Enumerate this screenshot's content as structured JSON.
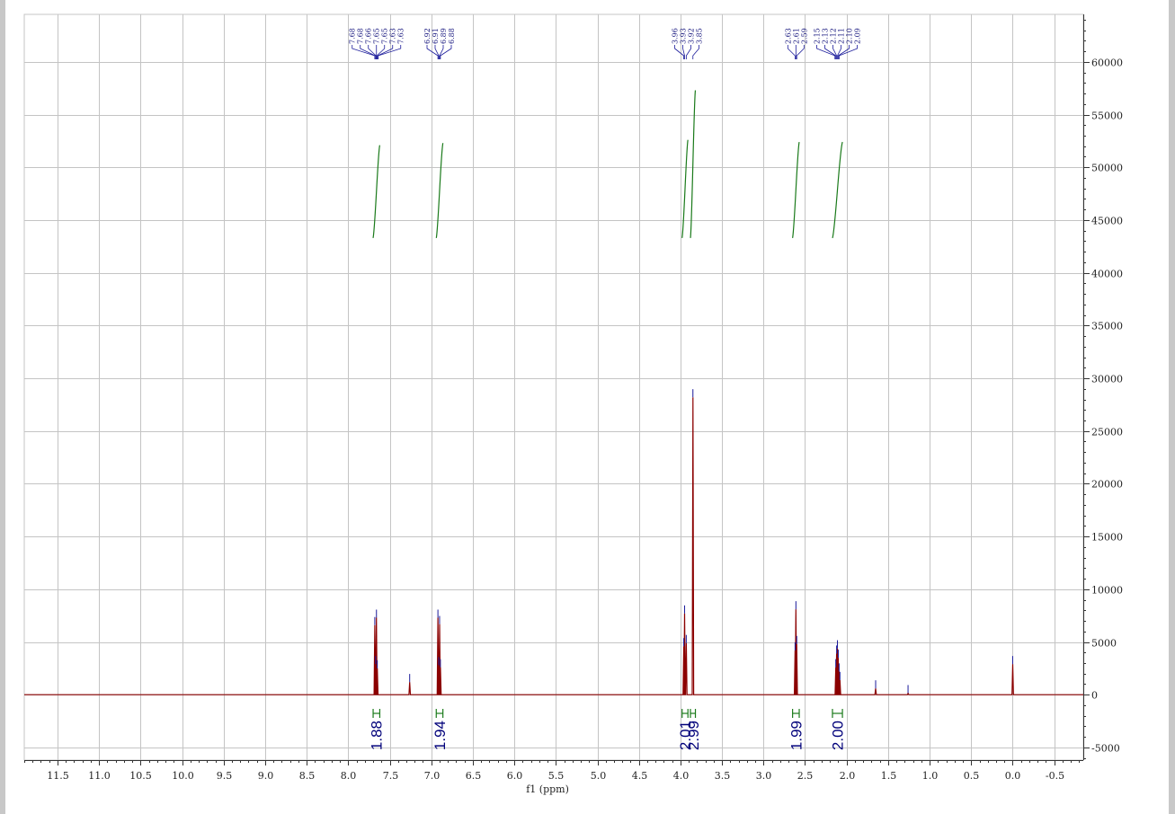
{
  "chart_data": {
    "type": "line",
    "title": "",
    "xlabel": "f1 (ppm)",
    "ylabel": "",
    "xlim": [
      11.9,
      -0.85
    ],
    "ylim": [
      -6200,
      64500
    ],
    "x_ticks": [
      11.5,
      11.0,
      10.5,
      10.0,
      9.5,
      9.0,
      8.5,
      8.0,
      7.5,
      7.0,
      6.5,
      6.0,
      5.5,
      5.0,
      4.5,
      4.0,
      3.5,
      3.0,
      2.5,
      2.0,
      1.5,
      1.0,
      0.5,
      0.0,
      -0.5
    ],
    "x_tick_labels": [
      "11.5",
      "11.0",
      "10.5",
      "10.0",
      "9.5",
      "9.0",
      "8.5",
      "8.0",
      "7.5",
      "7.0",
      "6.5",
      "6.0",
      "5.5",
      "5.0",
      "4.5",
      "4.0",
      "3.5",
      "3.0",
      "2.5",
      "2.0",
      "1.5",
      "1.0",
      "0.5",
      "0.0",
      "-0.5"
    ],
    "y_ticks": [
      -5000,
      0,
      5000,
      10000,
      15000,
      20000,
      25000,
      30000,
      35000,
      40000,
      45000,
      50000,
      55000,
      60000
    ],
    "y_tick_labels": [
      "-5000",
      "0",
      "5000",
      "10000",
      "15000",
      "20000",
      "25000",
      "30000",
      "35000",
      "40000",
      "45000",
      "50000",
      "55000",
      "60000"
    ],
    "grid": true,
    "peaks": [
      {
        "x": 7.68,
        "y": 6600
      },
      {
        "x": 7.67,
        "y": 2900
      },
      {
        "x": 7.66,
        "y": 7300
      },
      {
        "x": 7.65,
        "y": 2500
      },
      {
        "x": 6.92,
        "y": 7300
      },
      {
        "x": 6.91,
        "y": 2800
      },
      {
        "x": 6.9,
        "y": 6700
      },
      {
        "x": 6.89,
        "y": 2600
      },
      {
        "x": 7.26,
        "y": 1200
      },
      {
        "x": 3.96,
        "y": 4600
      },
      {
        "x": 3.95,
        "y": 7700
      },
      {
        "x": 3.93,
        "y": 4900
      },
      {
        "x": 3.85,
        "y": 28200
      },
      {
        "x": 2.62,
        "y": 4200
      },
      {
        "x": 2.61,
        "y": 8100
      },
      {
        "x": 2.6,
        "y": 4800
      },
      {
        "x": 2.13,
        "y": 2600
      },
      {
        "x": 2.12,
        "y": 3900
      },
      {
        "x": 2.11,
        "y": 4400
      },
      {
        "x": 2.1,
        "y": 3500
      },
      {
        "x": 2.09,
        "y": 2200
      },
      {
        "x": 2.08,
        "y": 1400
      },
      {
        "x": 1.65,
        "y": 600
      },
      {
        "x": 1.26,
        "y": 150
      },
      {
        "x": 0.0,
        "y": 2900
      }
    ],
    "integrals": [
      {
        "from": 7.7,
        "to": 7.62,
        "start_y": 43300,
        "end_y": 52100,
        "value": "1.88"
      },
      {
        "from": 6.94,
        "to": 6.86,
        "start_y": 43300,
        "end_y": 52300,
        "value": "1.94"
      },
      {
        "from": 3.98,
        "to": 3.91,
        "start_y": 43300,
        "end_y": 52600,
        "value": "2.01"
      },
      {
        "from": 3.88,
        "to": 3.82,
        "start_y": 43300,
        "end_y": 57300,
        "value": "2.99"
      },
      {
        "from": 2.65,
        "to": 2.57,
        "start_y": 43300,
        "end_y": 52400,
        "value": "1.99"
      },
      {
        "from": 2.17,
        "to": 2.05,
        "start_y": 43300,
        "end_y": 52400,
        "value": "2.00"
      }
    ],
    "peak_label_groups": [
      {
        "labels": [
          "7.68",
          "7.68",
          "7.66",
          "7.65",
          "7.65",
          "7.63",
          "7.63"
        ],
        "points": [
          7.68,
          7.675,
          7.665,
          7.66,
          7.655,
          7.645,
          7.64
        ]
      },
      {
        "labels": [
          "6.92",
          "6.91",
          "6.89",
          "6.88"
        ],
        "points": [
          6.92,
          6.91,
          6.9,
          6.89
        ]
      },
      {
        "labels": [
          "3.96",
          "3.93",
          "3.92",
          "3.85"
        ],
        "points": [
          3.96,
          3.95,
          3.93,
          3.85
        ]
      },
      {
        "labels": [
          "2.63",
          "2.61",
          "2.59"
        ],
        "points": [
          2.62,
          2.61,
          2.6
        ]
      },
      {
        "labels": [
          "2.15",
          "2.13",
          "2.12",
          "2.11",
          "2.10",
          "2.09"
        ],
        "points": [
          2.14,
          2.13,
          2.12,
          2.11,
          2.1,
          2.09
        ]
      }
    ],
    "colors": {
      "spectrum": "#8b0000",
      "integral_curve": "#1a7a1a",
      "integral_bracket": "#1a7a1a",
      "integral_label": "#00007a",
      "peak_marker": "#1a1a9a",
      "grid": "#c4c4c4"
    }
  }
}
